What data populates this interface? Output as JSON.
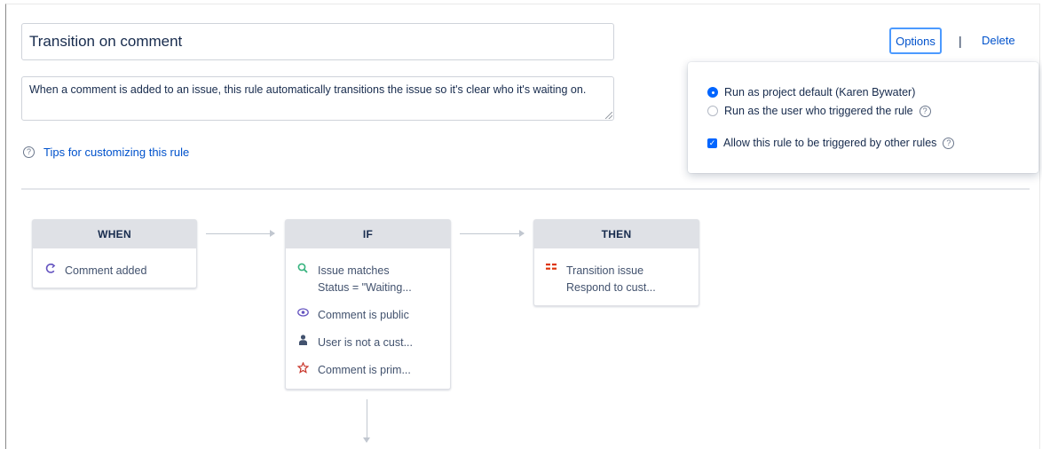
{
  "rule": {
    "title": "Transition on comment",
    "description": "When a comment is added to an issue, this rule automatically transitions the issue so it's clear who it's waiting on.",
    "tips_link": "Tips for customizing this rule"
  },
  "header_actions": {
    "options_label": "Options",
    "separator": "|",
    "delete_label": "Delete"
  },
  "options_panel": {
    "run_as_default": "Run as project default (Karen Bywater)",
    "run_as_trigger_user": "Run as the user who triggered the rule",
    "allow_triggered": "Allow this rule to be triggered by other rules",
    "selected": "run_as_default",
    "allow_triggered_checked": true
  },
  "flow": {
    "when": {
      "label": "WHEN",
      "items": [
        {
          "icon": "comment-added-icon",
          "lines": [
            "Comment added"
          ],
          "color": "#6554c0"
        }
      ]
    },
    "if": {
      "label": "IF",
      "items": [
        {
          "icon": "search-icon",
          "lines": [
            "Issue matches",
            "Status = \"Waiting..."
          ],
          "color": "#36b37e"
        },
        {
          "icon": "eye-icon",
          "lines": [
            "Comment is public"
          ],
          "color": "#6554c0"
        },
        {
          "icon": "user-icon",
          "lines": [
            "User is not a cust..."
          ],
          "color": "#42526e"
        },
        {
          "icon": "star-icon",
          "lines": [
            "Comment is prim..."
          ],
          "color": "#c9372c"
        }
      ]
    },
    "then": {
      "label": "THEN",
      "items": [
        {
          "icon": "transition-icon",
          "lines": [
            "Transition issue",
            "Respond to cust..."
          ],
          "color": "#de350b"
        }
      ]
    }
  }
}
